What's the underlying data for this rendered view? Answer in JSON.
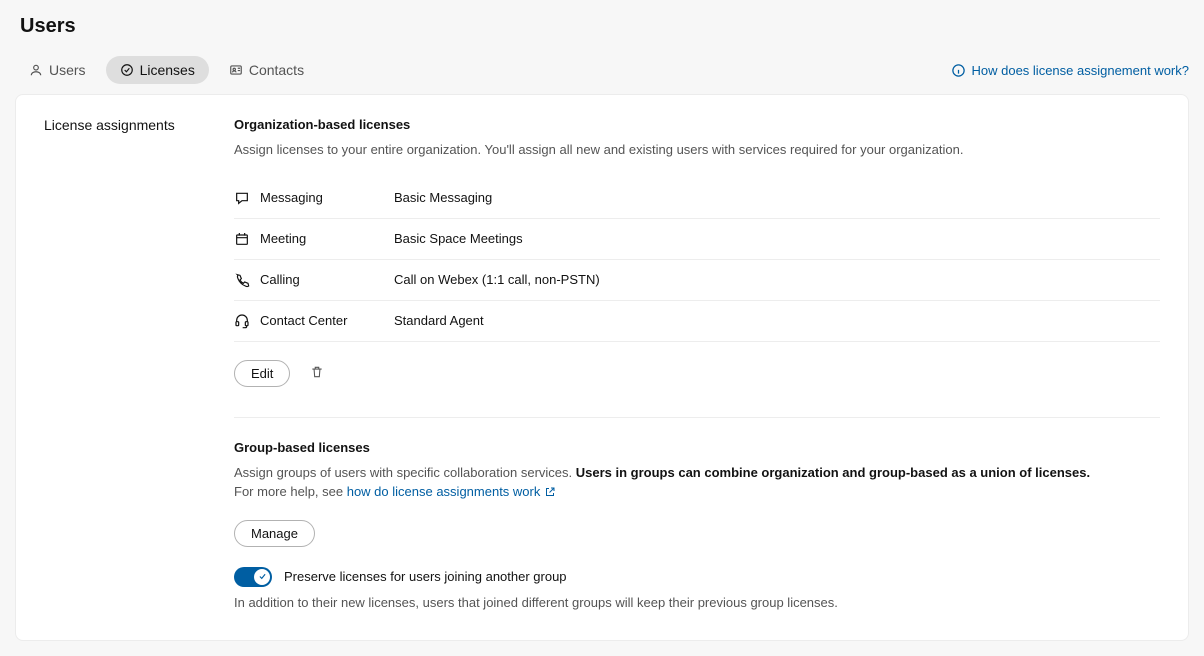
{
  "page_title": "Users",
  "tabs": {
    "users": "Users",
    "licenses": "Licenses",
    "contacts": "Contacts"
  },
  "help_link": "How does license assignement work?",
  "left_heading": "License assignments",
  "org": {
    "title": "Organization-based licenses",
    "desc": "Assign licenses to your entire organization. You'll assign all new and existing users with services required for your organization.",
    "rows": {
      "messaging_label": "Messaging",
      "messaging_value": "Basic Messaging",
      "meeting_label": "Meeting",
      "meeting_value": "Basic Space Meetings",
      "calling_label": "Calling",
      "calling_value": "Call on Webex (1:1 call, non-PSTN)",
      "contact_center_label": "Contact Center",
      "contact_center_value": "Standard Agent"
    },
    "edit_label": "Edit"
  },
  "group": {
    "title": "Group-based licenses",
    "desc_part1": "Assign groups of users with specific collaboration services. ",
    "desc_bold": "Users in groups can combine organization and group-based as a union of licenses.",
    "desc_part2_prefix": "For more help, see ",
    "desc_link": "how do license assignments work",
    "manage_label": "Manage",
    "toggle_label": "Preserve licenses for users joining another group",
    "toggle_desc": "In addition to their new licenses, users that joined different groups will keep their previous group licenses."
  }
}
